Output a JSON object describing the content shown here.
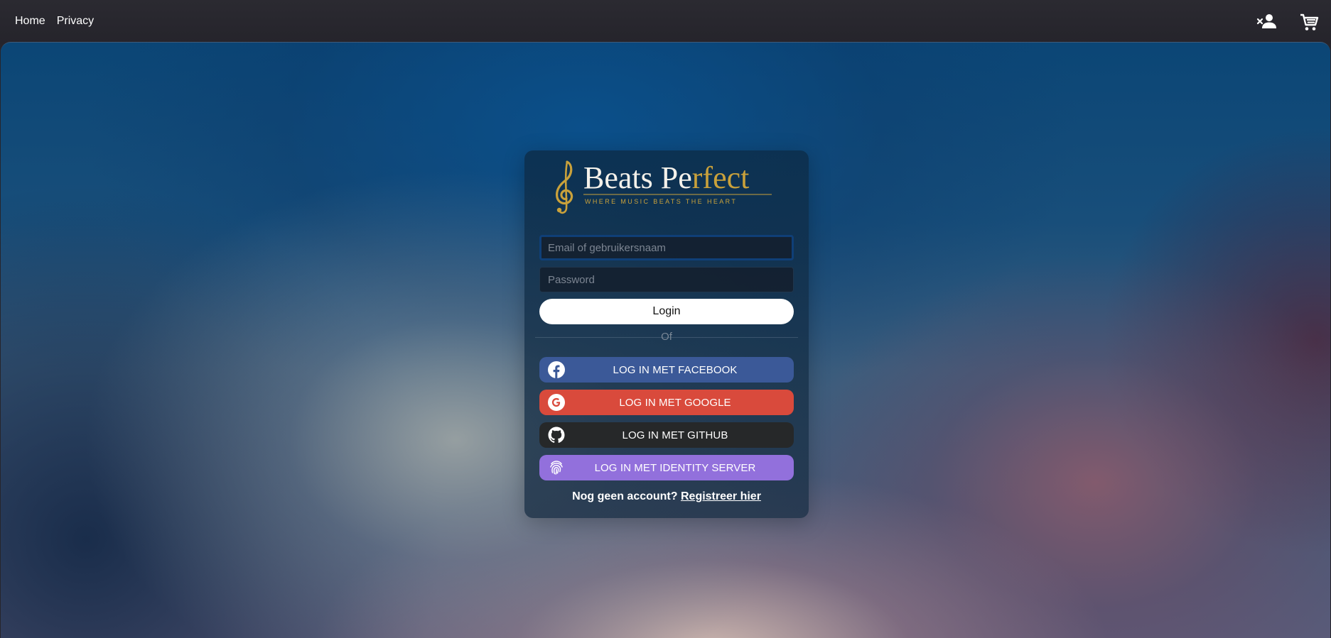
{
  "nav": {
    "links": [
      "Home",
      "Privacy"
    ],
    "icons": [
      "person-add-icon",
      "cart-icon"
    ]
  },
  "brand": {
    "name_part1": "Beats Pe",
    "name_part2": "rfect",
    "tagline": "WHERE MUSIC BEATS THE HEART",
    "gold": "#c9a13b"
  },
  "form": {
    "email_placeholder": "Email of gebruikersnaam",
    "password_placeholder": "Password",
    "login_label": "Login",
    "divider_label": "Of"
  },
  "social": {
    "facebook": {
      "label": "LOG IN MET FACEBOOK",
      "color": "#3b5998",
      "icon": "facebook-icon"
    },
    "google": {
      "label": "LOG IN MET GOOGLE",
      "color": "#d94a3c",
      "icon": "google-icon"
    },
    "github": {
      "label": "LOG IN MET GITHUB",
      "color": "#262829",
      "icon": "github-icon"
    },
    "identity": {
      "label": "LOG IN MET IDENTITY SERVER",
      "color": "#9270dc",
      "icon": "fingerprint-icon"
    }
  },
  "register": {
    "prompt": "Nog geen account?",
    "link": "Registreer hier"
  }
}
